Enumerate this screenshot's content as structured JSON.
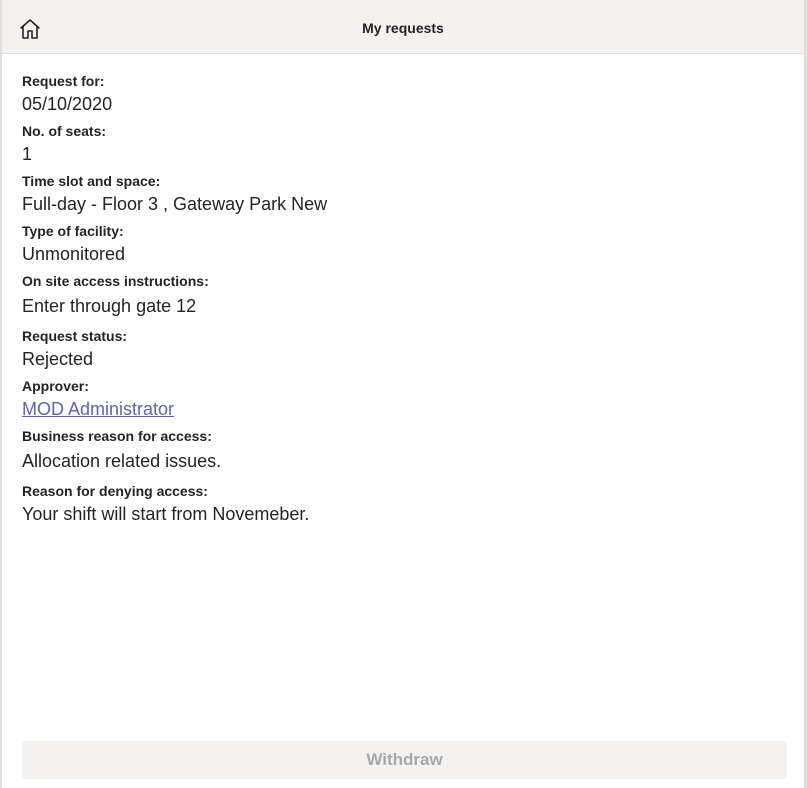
{
  "header": {
    "title": "My requests",
    "home_icon": "home-icon"
  },
  "details": {
    "request_for_label": "Request for:",
    "request_for_value": "05/10/2020",
    "seats_label": "No. of seats:",
    "seats_value": "1",
    "timeslot_label": "Time slot and space:",
    "timeslot_value": "Full-day - Floor 3 , Gateway Park New",
    "facility_label": "Type of facility:",
    "facility_value": "Unmonitored",
    "instructions_label": "On site access instructions:",
    "instructions_value": "Enter through gate 12",
    "status_label": "Request status:",
    "status_value": "Rejected",
    "approver_label": "Approver:",
    "approver_value": "MOD Administrator",
    "business_reason_label": "Business reason for access:",
    "business_reason_value": "Allocation related issues.",
    "deny_reason_label": "Reason for denying access:",
    "deny_reason_value": "Your shift will start from Novemeber."
  },
  "actions": {
    "withdraw_label": "Withdraw"
  },
  "colors": {
    "header_bg": "#f3f2f1",
    "link": "#6264a7",
    "disabled_text": "#a8a8a8"
  }
}
